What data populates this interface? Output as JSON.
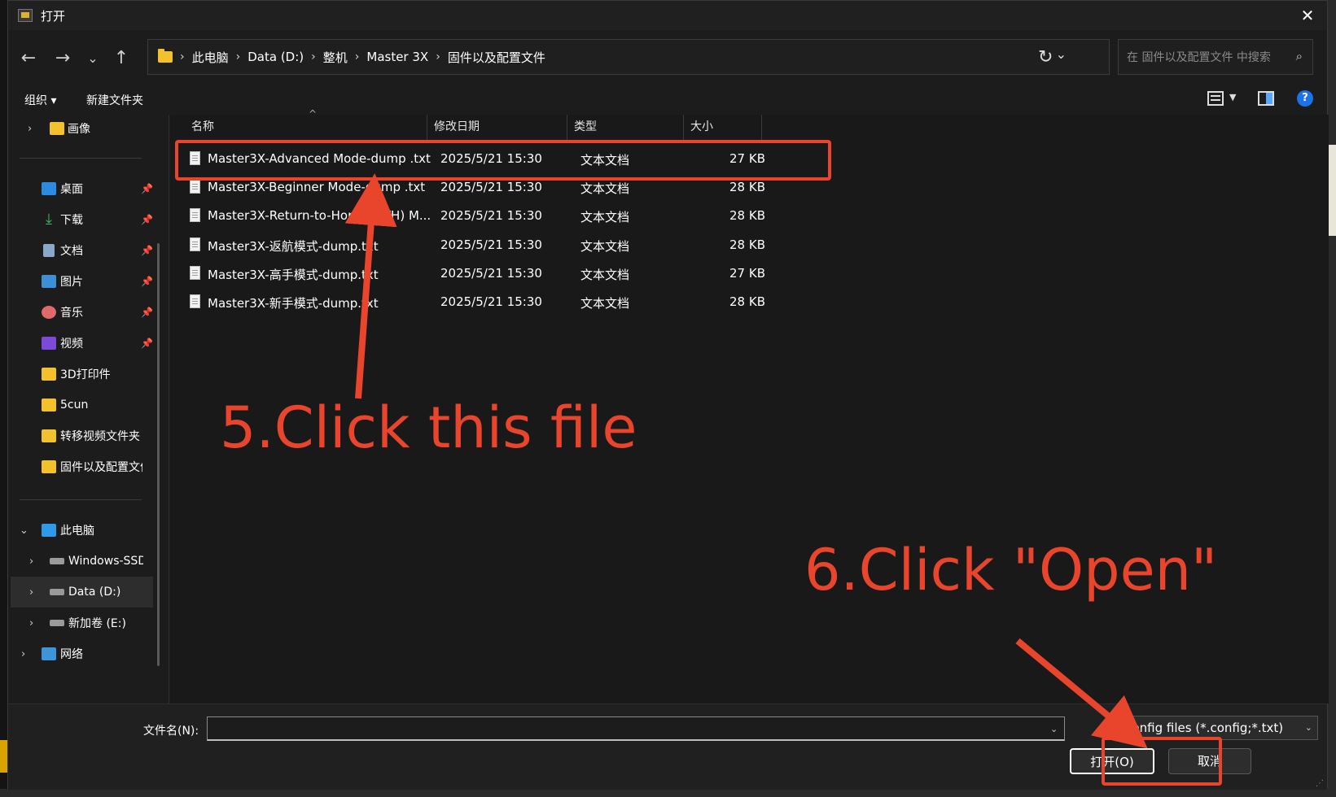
{
  "window": {
    "title": "打开"
  },
  "nav": {
    "breadcrumbs": [
      "此电脑",
      "Data (D:)",
      "整机",
      "Master 3X",
      "固件以及配置文件"
    ],
    "search_placeholder": "在 固件以及配置文件 中搜索"
  },
  "toolbar": {
    "organize_label": "组织 ▾",
    "new_folder_label": "新建文件夹"
  },
  "sidebar": {
    "items": [
      {
        "label": "画像",
        "icon": "folder-icon"
      },
      {
        "label": "桌面",
        "icon": "desktop-icon",
        "pinned": true
      },
      {
        "label": "下载",
        "icon": "download-icon",
        "pinned": true
      },
      {
        "label": "文档",
        "icon": "document-icon",
        "pinned": true
      },
      {
        "label": "图片",
        "icon": "pictures-icon",
        "pinned": true
      },
      {
        "label": "音乐",
        "icon": "music-icon",
        "pinned": true
      },
      {
        "label": "视频",
        "icon": "video-icon",
        "pinned": true
      },
      {
        "label": "3D打印件",
        "icon": "folder-icon"
      },
      {
        "label": "5cun",
        "icon": "folder-icon"
      },
      {
        "label": "转移视频文件夹",
        "icon": "folder-icon"
      },
      {
        "label": "固件以及配置文件",
        "icon": "folder-icon"
      },
      {
        "label": "此电脑",
        "icon": "pc-icon"
      },
      {
        "label": "Windows-SSD",
        "icon": "drive-icon"
      },
      {
        "label": "Data (D:)",
        "icon": "drive-icon",
        "selected": true
      },
      {
        "label": "新加卷 (E:)",
        "icon": "drive-icon"
      },
      {
        "label": "网络",
        "icon": "network-icon"
      }
    ]
  },
  "columns": {
    "name": "名称",
    "modified": "修改日期",
    "type": "类型",
    "size": "大小"
  },
  "files": [
    {
      "name": "Master3X-Advanced Mode-dump .txt",
      "modified": "2025/5/21 15:30",
      "type": "文本文档",
      "size": "27 KB"
    },
    {
      "name": "Master3X-Beginner Mode-dump .txt",
      "modified": "2025/5/21 15:30",
      "type": "文本文档",
      "size": "28 KB"
    },
    {
      "name": "Master3X-Return-to-Home (RTH) M...",
      "modified": "2025/5/21 15:30",
      "type": "文本文档",
      "size": "28 KB"
    },
    {
      "name": "Master3X-返航模式-dump.txt",
      "modified": "2025/5/21 15:30",
      "type": "文本文档",
      "size": "28 KB"
    },
    {
      "name": "Master3X-高手模式-dump.txt",
      "modified": "2025/5/21 15:30",
      "type": "文本文档",
      "size": "27 KB"
    },
    {
      "name": "Master3X-新手模式-dump.txt",
      "modified": "2025/5/21 15:30",
      "type": "文本文档",
      "size": "28 KB"
    }
  ],
  "footer": {
    "filename_label": "文件名(N):",
    "filename_value": "",
    "filter_value": "Config files (*.config;*.txt)",
    "open_label": "打开(O)",
    "cancel_label": "取消"
  },
  "annotations": {
    "step5": "5.Click this file",
    "step6": "6.Click \"Open\"",
    "color": "#e8452c"
  }
}
